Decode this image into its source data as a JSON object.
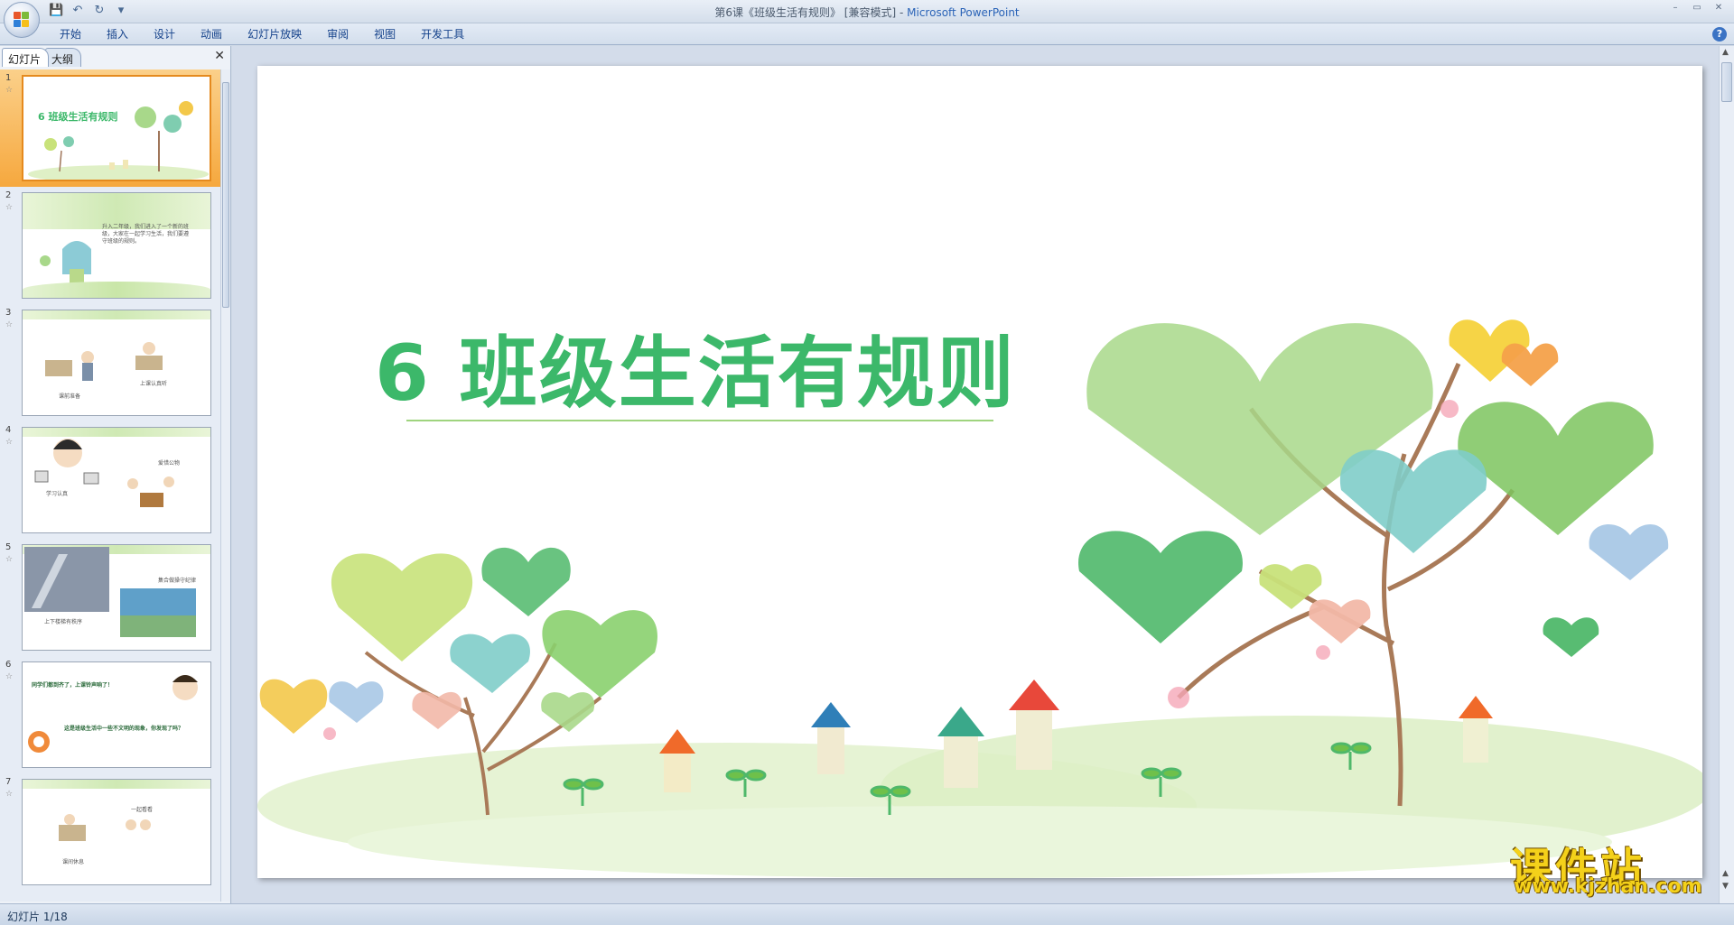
{
  "window": {
    "title_doc": "第6课《班级生活有规则》 [兼容模式] - ",
    "title_app": "Microsoft PowerPoint",
    "controls": [
      "–",
      "▭",
      "✕"
    ]
  },
  "quick_access": [
    "save-icon",
    "undo-icon",
    "redo-icon",
    "customize-icon"
  ],
  "ribbon": {
    "tabs": [
      "开始",
      "插入",
      "设计",
      "动画",
      "幻灯片放映",
      "审阅",
      "视图",
      "开发工具"
    ]
  },
  "left_panel": {
    "tabs": [
      "幻灯片",
      "大纲"
    ],
    "close": "✕",
    "slides": [
      {
        "num": "1",
        "title": "6 班级生活有规则"
      },
      {
        "num": "2",
        "text": "升入二年级，我们进入了一个新的班级，大家在一起学习生活，我们要遵守班级的规则。"
      },
      {
        "num": "3",
        "captions": [
          "课前准备",
          "上课认真听"
        ]
      },
      {
        "num": "4",
        "captions": [
          "学习认真",
          "爱惜公物"
        ]
      },
      {
        "num": "5",
        "captions": [
          "上下楼梯有秩序",
          "集合做操守纪律"
        ]
      },
      {
        "num": "6",
        "captions": [
          "同学们都到齐了，上课铃声响了！",
          "这是班级生活中一些不文明的现象，你发现了吗？"
        ]
      },
      {
        "num": "7",
        "captions": [
          "一起看看",
          "课间休息"
        ]
      }
    ]
  },
  "slide": {
    "title": "6 班级生活有规则"
  },
  "status": {
    "slide_counter": "幻灯片 1/18"
  },
  "watermark": {
    "cn": "课件站",
    "url": "www.kjzhan.com"
  },
  "colors": {
    "title_green": "#3cb86a",
    "selected_orange": "#f6a83e"
  }
}
